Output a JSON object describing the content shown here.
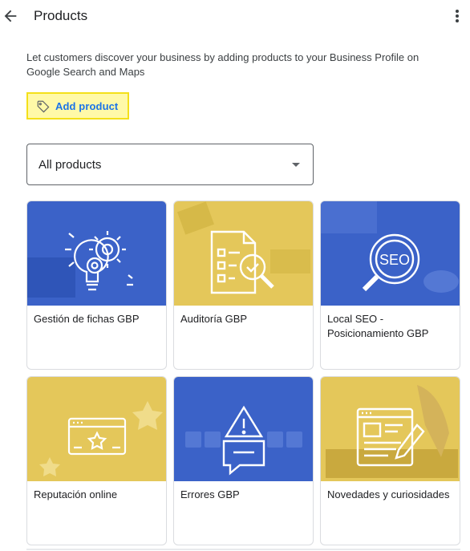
{
  "header": {
    "title": "Products"
  },
  "description": "Let customers discover your business by adding products to your Business Profile on Google Search and Maps",
  "add_product": {
    "label": "Add product",
    "icon": "tag-icon"
  },
  "filter": {
    "selected": "All products"
  },
  "products": [
    {
      "name": "Gestión de fichas GBP",
      "theme": "blue",
      "icon": "lightbulb-gears-icon"
    },
    {
      "name": "Auditoría GBP",
      "theme": "yellow",
      "icon": "checklist-magnifier-icon"
    },
    {
      "name": "Local SEO - Posicionamiento GBP",
      "theme": "blue",
      "icon": "seo-magnifier-icon"
    },
    {
      "name": "Reputación online",
      "theme": "yellow",
      "icon": "browser-star-icon"
    },
    {
      "name": "Errores GBP",
      "theme": "blue",
      "icon": "warning-chat-icon"
    },
    {
      "name": "Novedades y curiosidades",
      "theme": "yellow",
      "icon": "news-pen-icon"
    }
  ],
  "colors": {
    "accent": "#1a73e8",
    "highlight": "#f4e01a",
    "blue_tile": "#3b62c8",
    "yellow_tile": "#e4c75a"
  }
}
